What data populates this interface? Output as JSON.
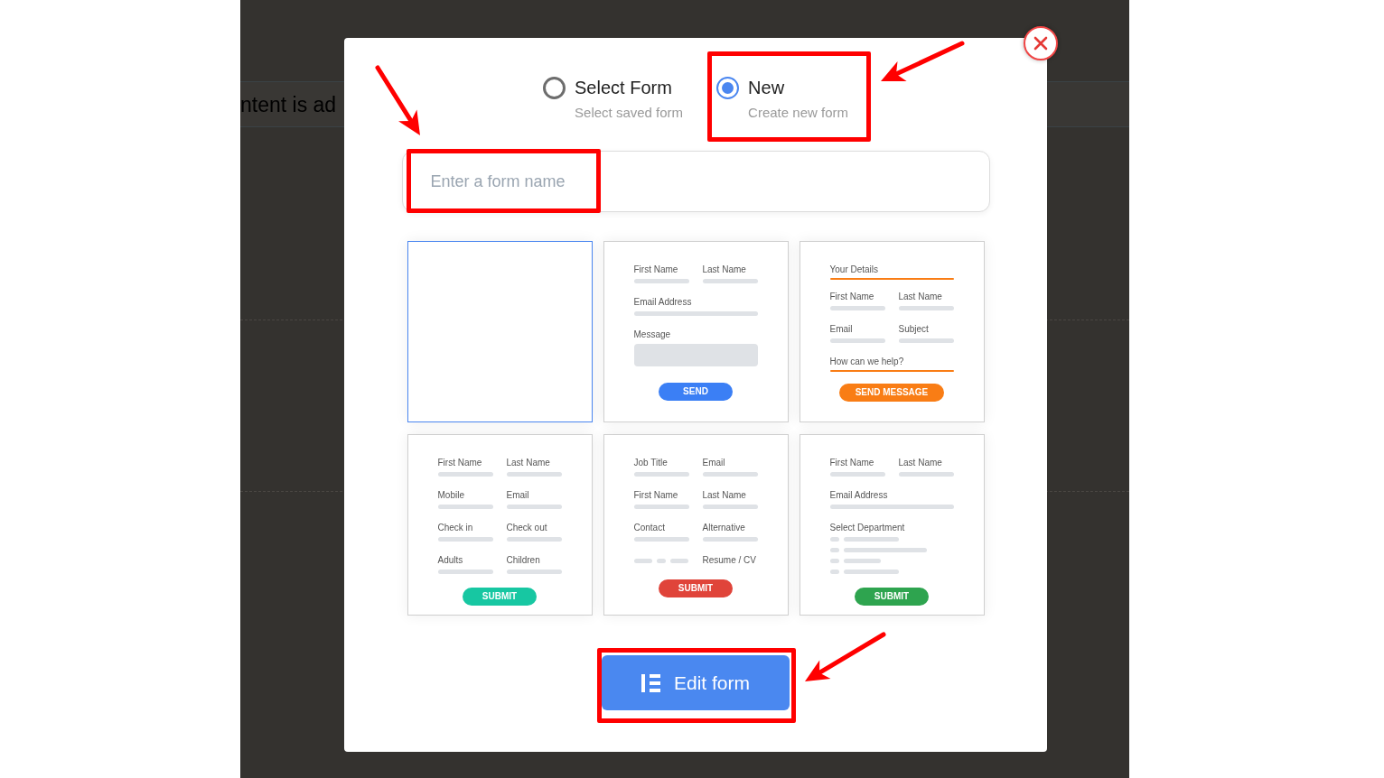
{
  "background_page": {
    "text": "ntent is ad"
  },
  "dialog": {
    "modes": [
      {
        "label": "Select Form",
        "description": "Select saved form",
        "selected": false,
        "highlighted": false
      },
      {
        "label": "New",
        "description": "Create new form",
        "selected": true,
        "highlighted": true
      }
    ],
    "form_name_field": {
      "placeholder": "Enter a form name",
      "highlighted": true
    },
    "templates": [
      {
        "kind": "blank",
        "selected": true
      },
      {
        "kind": "form",
        "selected": false,
        "rows": [
          {
            "kind": "pair",
            "labels": [
              "First Name",
              "Last Name"
            ]
          },
          {
            "kind": "field",
            "label": "Email Address"
          },
          {
            "kind": "textarea",
            "label": "Message"
          }
        ],
        "button": {
          "label": "SEND",
          "color": "#3b7ff5"
        }
      },
      {
        "kind": "form",
        "selected": false,
        "rows": [
          {
            "kind": "heading",
            "label": "Your Details"
          },
          {
            "kind": "pair",
            "labels": [
              "First Name",
              "Last Name"
            ]
          },
          {
            "kind": "pair",
            "labels": [
              "Email",
              "Subject"
            ]
          },
          {
            "kind": "heading",
            "label": "How can we help?"
          }
        ],
        "button": {
          "label": "SEND MESSAGE",
          "color": "#f97d15"
        }
      },
      {
        "kind": "form",
        "selected": false,
        "rows": [
          {
            "kind": "pair",
            "labels": [
              "First Name",
              "Last Name"
            ]
          },
          {
            "kind": "pair",
            "labels": [
              "Mobile",
              "Email"
            ]
          },
          {
            "kind": "pair",
            "labels": [
              "Check in",
              "Check out"
            ]
          },
          {
            "kind": "pair",
            "labels": [
              "Adults",
              "Children"
            ]
          }
        ],
        "button": {
          "label": "SUBMIT",
          "color": "#17c7a2"
        }
      },
      {
        "kind": "form",
        "selected": false,
        "rows": [
          {
            "kind": "pair",
            "labels": [
              "Job Title",
              "Email"
            ]
          },
          {
            "kind": "pair",
            "labels": [
              "First Name",
              "Last Name"
            ]
          },
          {
            "kind": "pair",
            "labels": [
              "Contact",
              "Alternative"
            ]
          },
          {
            "kind": "upload",
            "label": "Resume / CV"
          }
        ],
        "button": {
          "label": "SUBMIT",
          "color": "#e0443a"
        }
      },
      {
        "kind": "form",
        "selected": false,
        "rows": [
          {
            "kind": "pair",
            "labels": [
              "First Name",
              "Last Name"
            ]
          },
          {
            "kind": "field",
            "label": "Email Address"
          },
          {
            "kind": "choices",
            "label": "Select Department"
          }
        ],
        "button": {
          "label": "SUBMIT",
          "color": "#2ea44f"
        }
      }
    ],
    "edit_button": {
      "label": "Edit form",
      "highlighted": true
    }
  }
}
